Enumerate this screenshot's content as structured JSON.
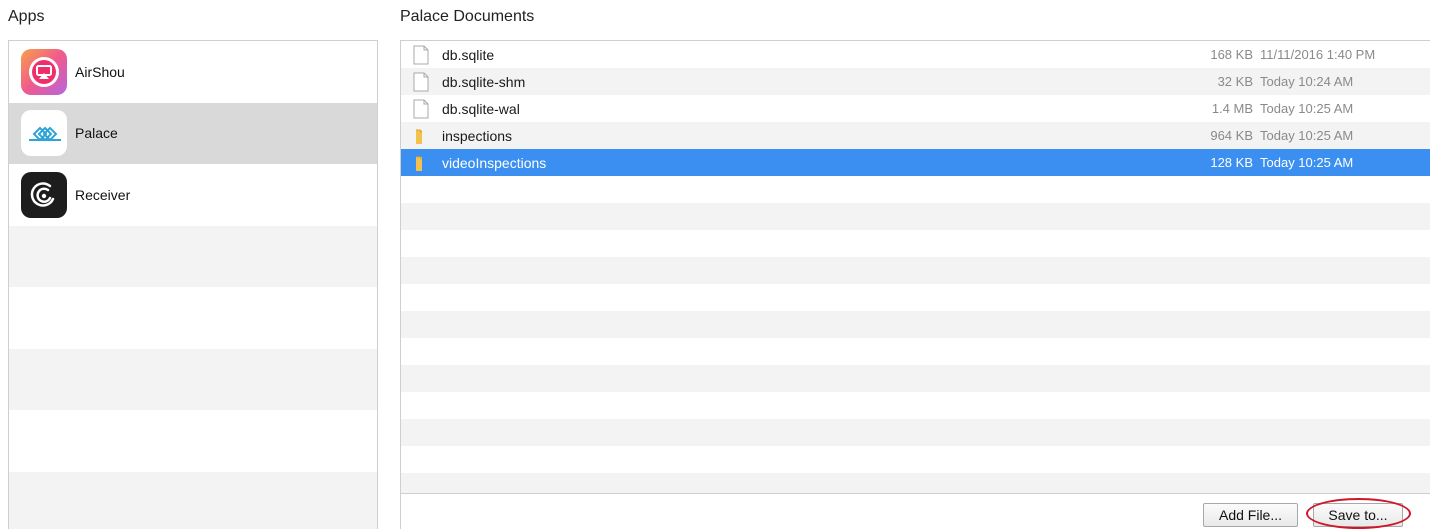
{
  "apps": {
    "title": "Apps",
    "items": [
      {
        "label": "AirShou",
        "icon": "airshou-icon"
      },
      {
        "label": "Palace",
        "icon": "palace-icon",
        "selected": true
      },
      {
        "label": "Receiver",
        "icon": "receiver-icon"
      }
    ]
  },
  "documents": {
    "title": "Palace Documents",
    "files": [
      {
        "name": "db.sqlite",
        "type": "file",
        "size": "168 KB",
        "date": "11/11/2016 1:40 PM"
      },
      {
        "name": "db.sqlite-shm",
        "type": "file",
        "size": "32 KB",
        "date": "Today 10:24 AM"
      },
      {
        "name": "db.sqlite-wal",
        "type": "file",
        "size": "1.4 MB",
        "date": "Today 10:25 AM"
      },
      {
        "name": "inspections",
        "type": "folder",
        "size": "964 KB",
        "date": "Today 10:25 AM"
      },
      {
        "name": "videoInspections",
        "type": "folder",
        "size": "128 KB",
        "date": "Today 10:25 AM",
        "selected": true
      }
    ]
  },
  "toolbar": {
    "add_file_label": "Add File...",
    "save_to_label": "Save to..."
  },
  "colors": {
    "selection": "#3a8ff0",
    "annotation": "#d0162a"
  }
}
